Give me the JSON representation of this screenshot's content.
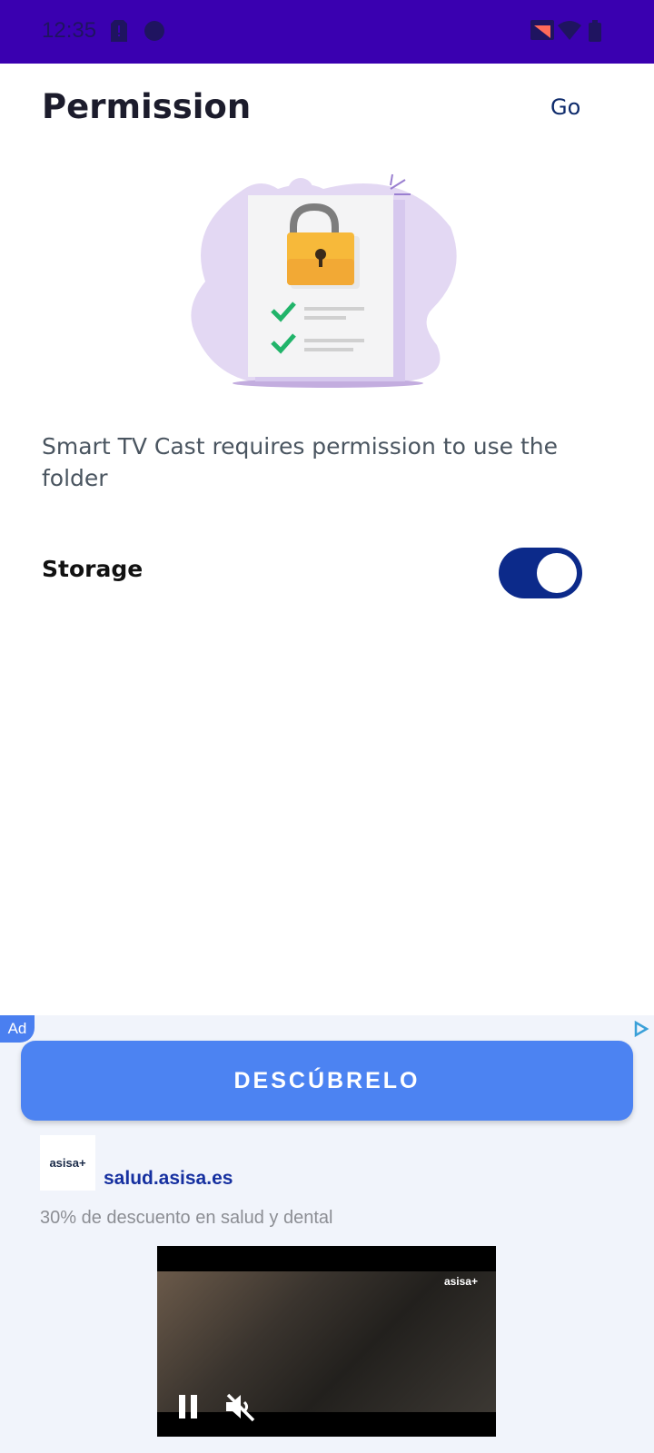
{
  "status_bar": {
    "time": "12:35"
  },
  "header": {
    "title": "Permission",
    "go_label": "Go"
  },
  "description": "Smart TV Cast requires permission to use the folder",
  "permission": {
    "label": "Storage",
    "enabled": true
  },
  "ad": {
    "badge": "Ad",
    "cta_label": "DESCÚBRELO",
    "advertiser_logo_text": "asisa+",
    "advertiser_url": "salud.asisa.es",
    "text": "30% de descuento en salud y dental",
    "video_brand": "asisa+"
  },
  "colors": {
    "status_bar": "#3a00b0",
    "toggle_on": "#0c2a8a",
    "cta": "#4c83f2",
    "link": "#1630a0"
  }
}
